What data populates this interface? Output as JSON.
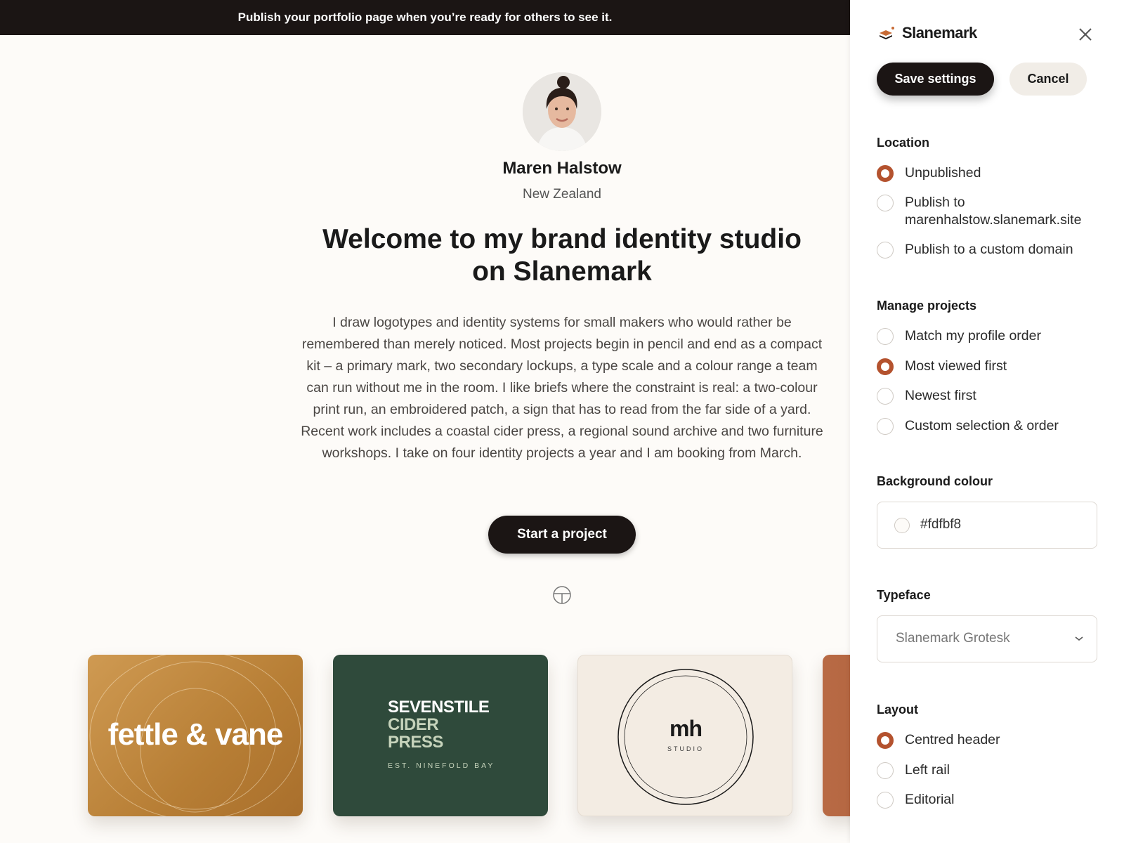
{
  "banner": {
    "text": "Publish your portfolio page when you’re ready for others to see it."
  },
  "profile": {
    "name": "Maren Halstow",
    "location": "New Zealand",
    "headline": "Welcome to my brand identity studio on Slanemark",
    "bio": "I draw logotypes and identity systems for small makers who would rather be remembered than merely noticed. Most projects begin in pencil and end as a compact kit – a primary mark, two secondary lockups, a type scale and a colour range a team can run without me in the room. I like briefs where the constraint is real: a two-colour print run, an embroidered patch, a sign that has to read from the far side of a yard. Recent work includes a coastal cider press, a regional sound archive and two furniture workshops. I take on four identity projects a year and I am booking from March.",
    "cta_label": "Start a project"
  },
  "projects": [
    {
      "title": "fettle & vane"
    },
    {
      "title_lines": [
        "SEVENSTILE",
        "CIDER",
        "PRESS"
      ],
      "subtitle": "EST. NINEFOLD BAY"
    },
    {
      "mark": "mh",
      "subtitle": "STUDIO"
    },
    {
      "title": ""
    }
  ],
  "panel": {
    "brand": "Slanemark",
    "save_label": "Save settings",
    "cancel_label": "Cancel",
    "location": {
      "title": "Location",
      "options": [
        {
          "label": "Unpublished",
          "selected": true
        },
        {
          "label": "Publish to marenhalstow.slanemark.site",
          "selected": false
        },
        {
          "label": "Publish to a custom domain",
          "selected": false
        }
      ]
    },
    "manage_projects": {
      "title": "Manage projects",
      "options": [
        {
          "label": "Match my profile order",
          "selected": false
        },
        {
          "label": "Most viewed first",
          "selected": true
        },
        {
          "label": "Newest first",
          "selected": false
        },
        {
          "label": "Custom selection & order",
          "selected": false
        }
      ]
    },
    "background_colour": {
      "title": "Background colour",
      "value": "#fdfbf8"
    },
    "typeface": {
      "title": "Typeface",
      "value": "Slanemark Grotesk"
    },
    "layout": {
      "title": "Layout",
      "options": [
        {
          "label": "Centred header",
          "selected": true
        },
        {
          "label": "Left rail",
          "selected": false
        },
        {
          "label": "Editorial",
          "selected": false
        }
      ]
    }
  },
  "colors": {
    "accent": "#b4522e",
    "dark": "#1b1514",
    "page_bg": "#fdfbf8"
  }
}
